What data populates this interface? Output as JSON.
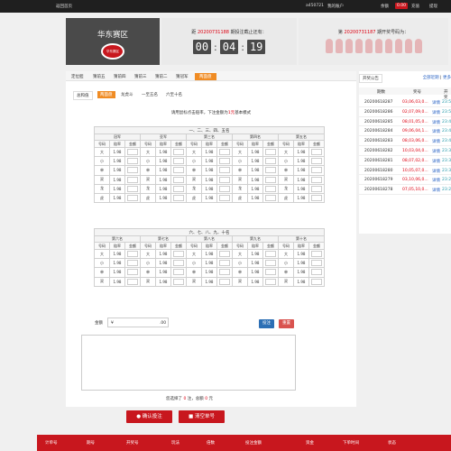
{
  "topbar": {
    "left": "返回首页",
    "user": "a450721",
    "menu": "我的账户",
    "balance_label": "余额",
    "pill": "0.00",
    "recharge": "充值",
    "withdraw": "提现"
  },
  "header": {
    "lottery_name": "华东赛区",
    "logo_text": "华东赛区",
    "issue_prefix": "距",
    "issue": "20200731188",
    "issue_suffix": "期投注截止还有：",
    "timer": [
      "00",
      "04",
      "19"
    ],
    "timer_sep": ":",
    "draw_prefix": "第",
    "draw_issue": "20200731187",
    "draw_suffix": "期开奖号码为："
  },
  "nav": {
    "tabs": [
      "定位胆",
      "猜前五",
      "猜前四",
      "猜前三",
      "猜前二",
      "猜冠军",
      "两面盘"
    ],
    "active": 6
  },
  "subnav": {
    "items": [
      "总和值",
      "两面盘",
      "龙虎斗",
      "一至五名",
      "六至十名"
    ],
    "active": 1
  },
  "hint": {
    "pre": "请用鼠标点击赔率，下注金额为",
    "red": "1元",
    "post": "基本模式"
  },
  "table1": {
    "title": "一、二、三、四、五名",
    "groups": [
      "冠军",
      "亚军",
      "第三名",
      "第四名",
      "第五名"
    ],
    "cols": [
      "号码",
      "赔率",
      "金额"
    ],
    "rows": [
      {
        "label": "大",
        "odds": "1.98"
      },
      {
        "label": "小",
        "odds": "1.98"
      },
      {
        "label": "单",
        "odds": "1.98"
      },
      {
        "label": "双",
        "odds": "1.98"
      },
      {
        "label": "龙",
        "odds": "1.98"
      },
      {
        "label": "虎",
        "odds": "1.98"
      }
    ]
  },
  "table2": {
    "title": "六、七、八、九、十名",
    "groups": [
      "第六名",
      "第七名",
      "第八名",
      "第九名",
      "第十名"
    ],
    "cols": [
      "号码",
      "赔率",
      "金额"
    ],
    "rows": [
      {
        "label": "大",
        "odds": "1.98"
      },
      {
        "label": "小",
        "odds": "1.98"
      },
      {
        "label": "单",
        "odds": "1.98"
      },
      {
        "label": "双",
        "odds": "1.98"
      }
    ]
  },
  "amount": {
    "label": "金额",
    "currency": "¥",
    "decimals": ".00"
  },
  "buttons": {
    "bet": "投注",
    "reset": "重置",
    "confirm": "确认投注",
    "clear": "清空单号"
  },
  "summary": {
    "pre": "您选择了",
    "count": "0",
    "mid": "注，总额",
    "total": "0",
    "post": "元"
  },
  "sidebar": {
    "tab": "开奖公告",
    "links": "全部近期",
    "links2": "|",
    "more": "更多",
    "cols": [
      "期数",
      "奖号",
      "开奖"
    ],
    "rows": [
      {
        "issue": "20200618287",
        "num": "03,06,03,0...",
        "detail": "详情",
        "dr": "23:5"
      },
      {
        "issue": "20200618286",
        "num": "02,07,09,0...",
        "detail": "详情",
        "dr": "23:5"
      },
      {
        "issue": "20200618285",
        "num": "08,01,05,0...",
        "detail": "详情",
        "dr": "23:4"
      },
      {
        "issue": "20200618284",
        "num": "09,06,04,1...",
        "detail": "详情",
        "dr": "23:4"
      },
      {
        "issue": "20200618283",
        "num": "08,03,06,0...",
        "detail": "详情",
        "dr": "23:4"
      },
      {
        "issue": "20200618282",
        "num": "10,03,04,0...",
        "detail": "详情",
        "dr": "23:3"
      },
      {
        "issue": "20200618281",
        "num": "08,07,02,0...",
        "detail": "详情",
        "dr": "23:3"
      },
      {
        "issue": "20200618280",
        "num": "10,05,07,0...",
        "detail": "详情",
        "dr": "23:3"
      },
      {
        "issue": "20200618279",
        "num": "03,10,06,0...",
        "detail": "详情",
        "dr": "23:2"
      },
      {
        "issue": "20200618278",
        "num": "07,05,10,0...",
        "detail": "详情",
        "dr": "23:2"
      }
    ]
  },
  "footer": {
    "items": [
      "计单号",
      "期号",
      "开奖号",
      "玩法",
      "倍数",
      "投注金额",
      "资金",
      "下单时间",
      "状态"
    ]
  },
  "colors": {
    "accent": "#f08c24",
    "brand": "#c8171e",
    "dark": "#1f1f1f"
  }
}
